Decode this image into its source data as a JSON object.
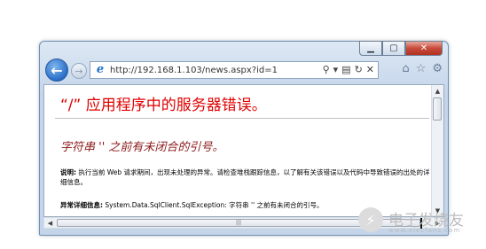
{
  "browser": {
    "url": "http://192.168.1.103/news.aspx?id=1'",
    "caption_buttons": [
      "minimize",
      "maximize",
      "close"
    ],
    "icons": {
      "back": "arrow-left-icon",
      "forward": "arrow-right-icon",
      "page": "ie-logo-icon",
      "search": "search-icon",
      "compat": "compatibility-view-icon",
      "refresh": "refresh-icon",
      "stop": "stop-icon",
      "home": "home-icon",
      "favorites": "star-icon",
      "tools": "gear-icon"
    },
    "glyphs": {
      "back": "←",
      "forward": "→",
      "page": "e",
      "search": "⚲",
      "dropdown": "▾",
      "compat": "▤",
      "refresh": "↻",
      "stop": "✕",
      "home": "⌂",
      "favorites": "☆",
      "tools": "⚙",
      "min": "▁",
      "max": "▢",
      "close": "✕",
      "scroll_up": "▲",
      "scroll_down": "▼",
      "scroll_left": "◀",
      "scroll_right": "▶",
      "grip": "|||"
    }
  },
  "page": {
    "title": "“/” 应用程序中的服务器错误。",
    "subtitle": "字符串 '' 之前有未闭合的引号。",
    "description_label": "说明:",
    "description_text": " 执行当前 Web 请求期间，出现未处理的异常。请检查堆栈跟踪信息，以了解有关该错误以及代码中导致错误的出处的详细信息。",
    "exception_label": "异常详细信息:",
    "exception_text": " System.Data.SqlClient.SqlException: 字符串 '' 之前有未闭合的引号。"
  },
  "watermark": {
    "text": "电子发烧友",
    "url": "www.elecfans.com",
    "colors": {
      "gray": "#bcbcbc"
    }
  },
  "colors": {
    "error_title": "#e00000",
    "error_subtitle": "#8b1a1a",
    "window_frame": "#c4d5ea",
    "close_button": "#c74a3a"
  }
}
